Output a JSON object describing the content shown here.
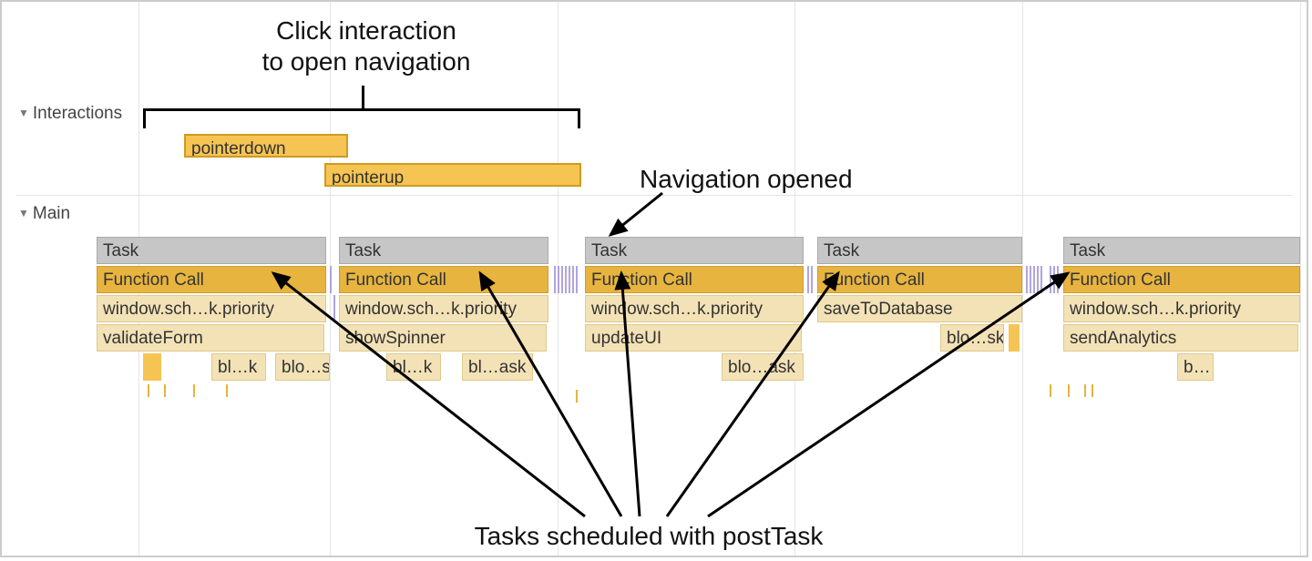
{
  "annotations": {
    "top": "Click interaction\nto open navigation",
    "nav_opened": "Navigation opened",
    "bottom": "Tasks scheduled with postTask"
  },
  "tracks": {
    "interactions": "Interactions",
    "main": "Main"
  },
  "interactions": {
    "pointerdown": "pointerdown",
    "pointerup": "pointerup"
  },
  "tasks": {
    "t1": {
      "task": "Task",
      "fn": "Function Call",
      "row3": "window.sch…k.priority",
      "row4": "validateForm",
      "row5a": "bl…k",
      "row5b": "blo…sk"
    },
    "t2": {
      "task": "Task",
      "fn": "Function Call",
      "row3": "window.sch…k.priority",
      "row4": "showSpinner",
      "row5a": "bl…k",
      "row5b": "bl…ask"
    },
    "t3": {
      "task": "Task",
      "fn": "Function Call",
      "row3": "window.sch…k.priority",
      "row4": "updateUI",
      "row5": "blo…ask"
    },
    "t4": {
      "task": "Task",
      "fn": "Function Call",
      "row3": "saveToDatabase",
      "row4": "blo…sk"
    },
    "t5": {
      "task": "Task",
      "fn": "Function Call",
      "row3": "window.sch…k.priority",
      "row4": "sendAnalytics",
      "row5": "b…"
    }
  },
  "colors": {
    "interaction_fill": "#f6c453",
    "interaction_border": "#cf9a20",
    "task_fill": "#c6c6c6",
    "fn_fill": "#e7b43f",
    "call_fill": "#f3e2b6"
  }
}
